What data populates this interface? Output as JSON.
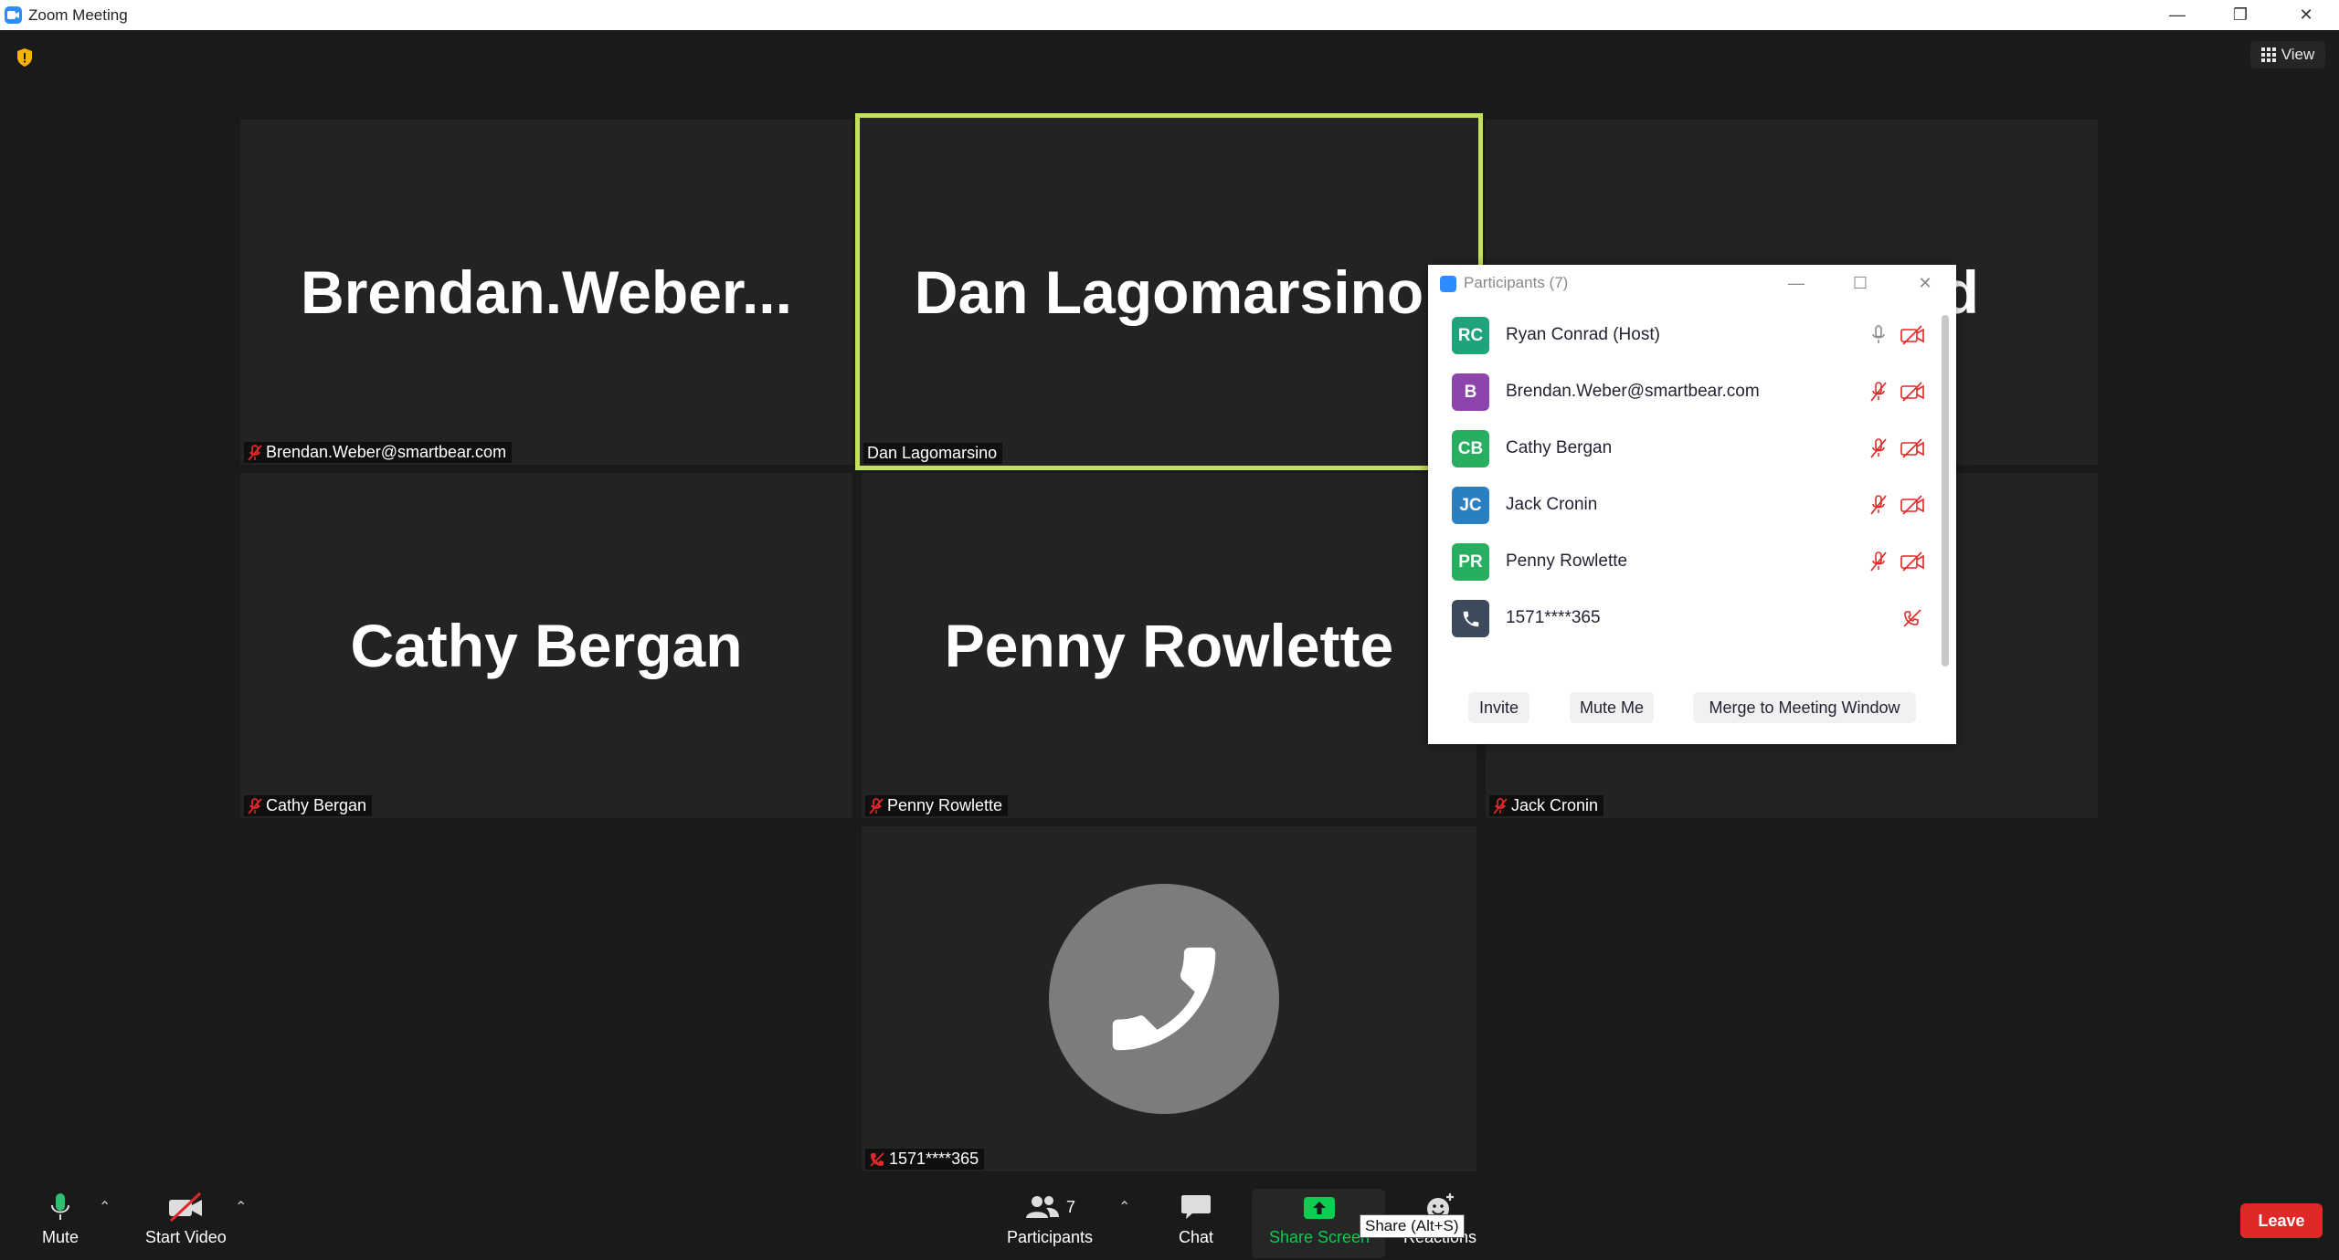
{
  "window": {
    "title": "Zoom Meeting",
    "minimize": "—",
    "restore": "❐",
    "close": "✕"
  },
  "header": {
    "view_label": "View"
  },
  "tiles": [
    {
      "big_name": "Brendan.Weber...",
      "tag": "Brendan.Weber@smartbear.com"
    },
    {
      "big_name": "Dan Lagomarsino",
      "tag": "Dan Lagomarsino"
    },
    {
      "big_name": "d",
      "tag": ""
    },
    {
      "big_name": "Cathy Bergan",
      "tag": "Cathy Bergan"
    },
    {
      "big_name": "Penny Rowlette",
      "tag": "Penny Rowlette"
    },
    {
      "big_name": "",
      "tag": "Jack Cronin"
    },
    {
      "big_name": "",
      "tag": "1571****365"
    }
  ],
  "participants_panel": {
    "title": "Participants (7)",
    "rows": [
      {
        "initials": "RC",
        "name": "Ryan Conrad (Host)",
        "color": "#1ea37a"
      },
      {
        "initials": "B",
        "name": "Brendan.Weber@smartbear.com",
        "color": "#8e44ad"
      },
      {
        "initials": "CB",
        "name": "Cathy Bergan",
        "color": "#27ae60"
      },
      {
        "initials": "JC",
        "name": "Jack Cronin",
        "color": "#2a7fc1"
      },
      {
        "initials": "PR",
        "name": "Penny Rowlette",
        "color": "#27ae60"
      },
      {
        "initials": "",
        "name": "1571****365",
        "color": "#3c4a5c"
      }
    ],
    "buttons": {
      "invite": "Invite",
      "mute_me": "Mute Me",
      "merge": "Merge to Meeting Window"
    }
  },
  "toolbar": {
    "mute": "Mute",
    "start_video": "Start Video",
    "participants": "Participants",
    "participants_count": "7",
    "chat": "Chat",
    "share_screen": "Share Screen",
    "share_tooltip": "Share (Alt+S)",
    "reactions": "Reactions",
    "leave": "Leave"
  },
  "colors": {
    "mute_red": "#e02828",
    "share_green": "#0ccc52",
    "active_speaker": "#c5e05a"
  }
}
